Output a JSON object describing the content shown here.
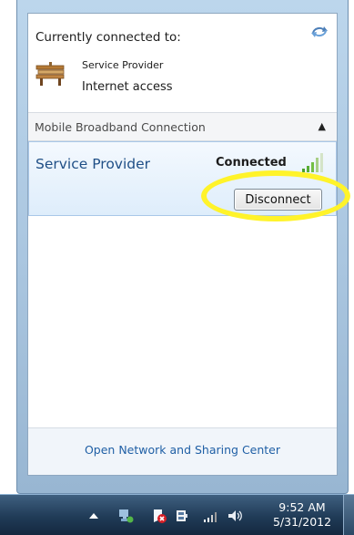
{
  "popup": {
    "current_label": "Currently connected to:",
    "network_name": "Service Provider",
    "network_access": "Internet access",
    "section_title": "Mobile Broadband Connection",
    "connection": {
      "name": "Service Provider",
      "status": "Connected",
      "button_label": "Disconnect"
    },
    "footer_link": "Open Network and Sharing Center"
  },
  "taskbar": {
    "time": "9:52 AM",
    "date": "5/31/2012"
  },
  "colors": {
    "highlight_ring": "#fff32a",
    "link_blue": "#1f5fa5",
    "connection_name": "#1f4f86"
  },
  "icons": [
    "refresh-icon",
    "network-bench-icon",
    "collapse-up-icon",
    "signal-bars-icon",
    "show-hidden-icons-arrow",
    "network-tray-icon",
    "action-center-icon",
    "power-icon",
    "signal-tray-icon",
    "volume-icon"
  ]
}
